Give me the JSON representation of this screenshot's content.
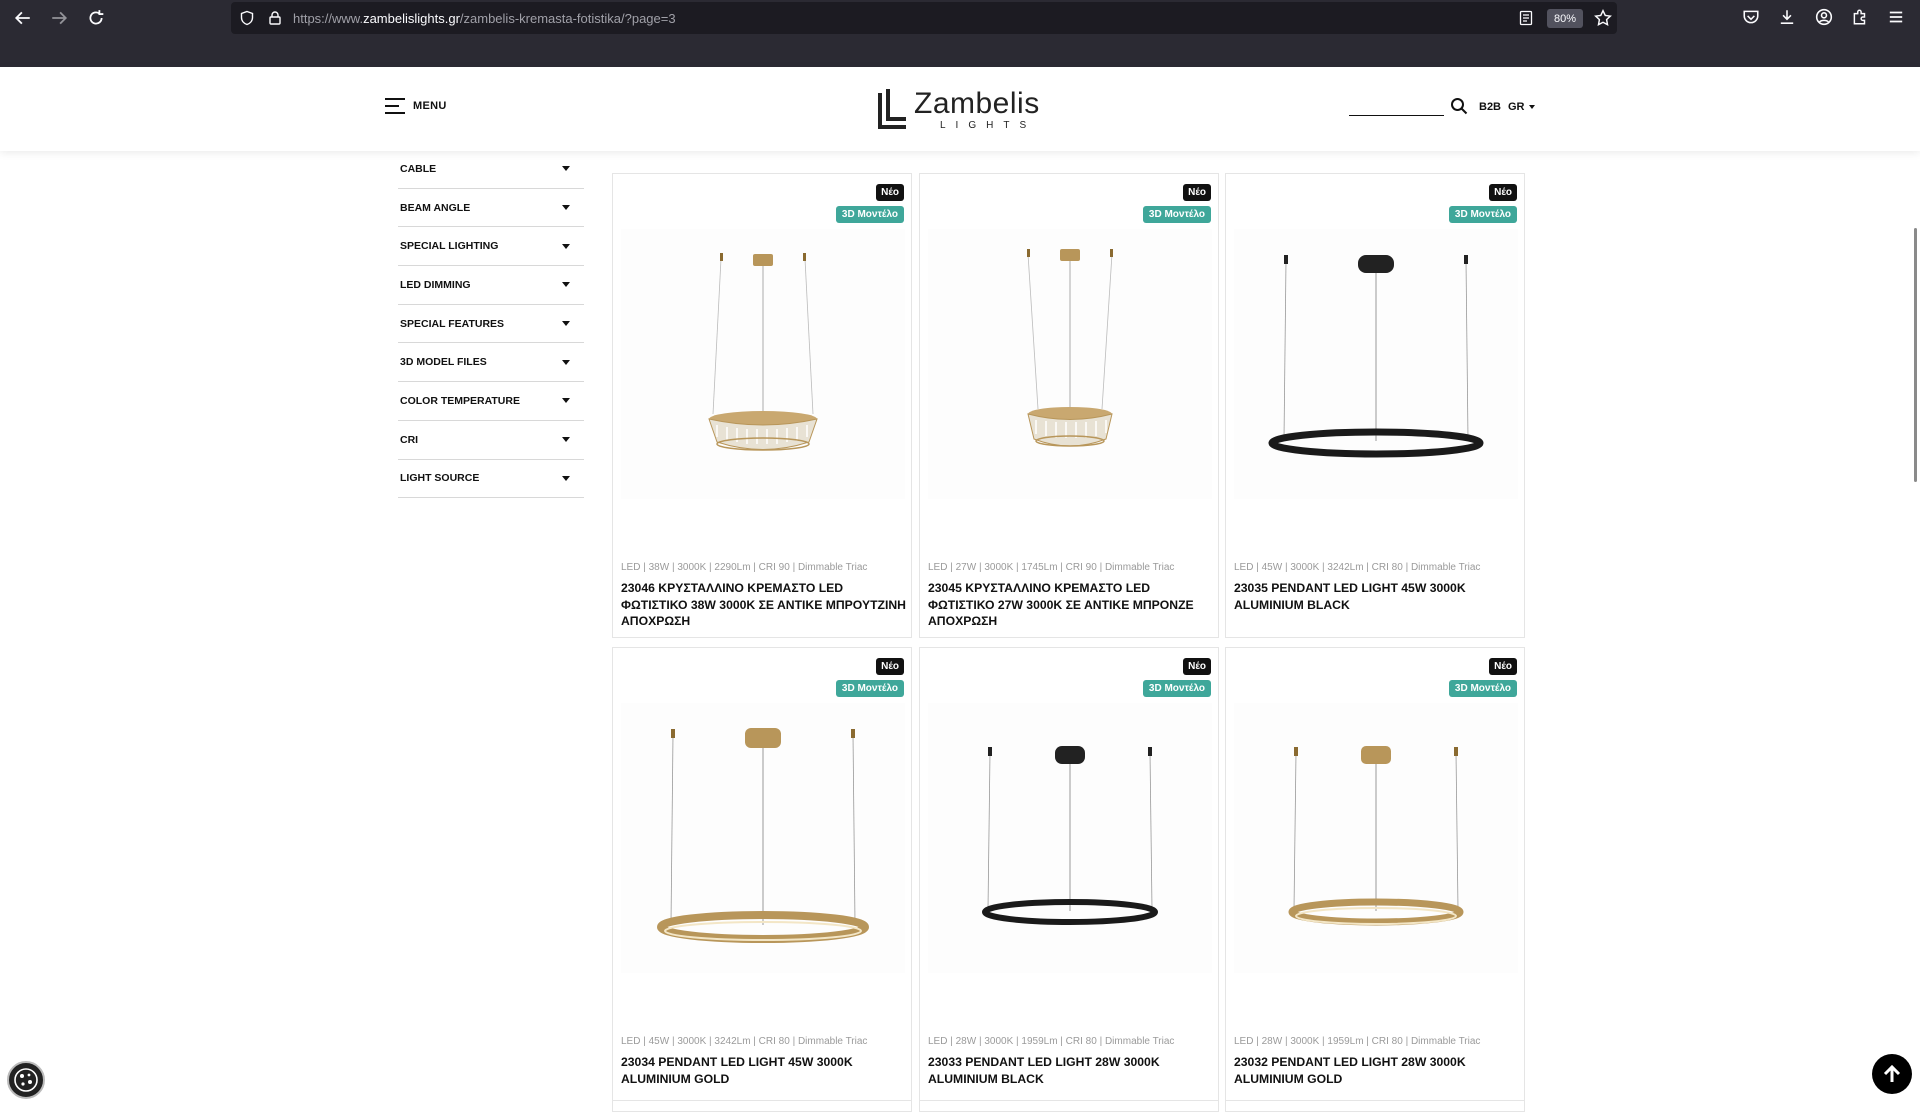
{
  "browser": {
    "url_prefix": "https://www.",
    "url_host": "zambelislights.gr",
    "url_path": "/zambelis-kremasta-fotistika/?page=3",
    "zoom": "80%"
  },
  "header": {
    "menu_label": "MENU",
    "logo_name": "Zambelis",
    "logo_sub": "LIGHTS",
    "b2b_label": "B2B",
    "lang_label": "GR"
  },
  "filters": [
    {
      "label": "CABLE"
    },
    {
      "label": "BEAM ANGLE"
    },
    {
      "label": "SPECIAL LIGHTING"
    },
    {
      "label": "LED DIMMING"
    },
    {
      "label": "SPECIAL FEATURES"
    },
    {
      "label": "3D MODEL FILES"
    },
    {
      "label": "COLOR TEMPERATURE"
    },
    {
      "label": "CRI"
    },
    {
      "label": "LIGHT SOURCE"
    }
  ],
  "badges": {
    "new": "Νέο",
    "model3d": "3D Μοντέλο"
  },
  "products": [
    {
      "specs": "LED | 38W | 3000K | 2290Lm | CRI 90 | Dimmable Triac",
      "title": "23046 ΚΡΥΣΤΑΛΛΙΝΟ ΚΡΕΜΑΣΤΟ LED ΦΩΤΙΣΤΙΚΟ 38W 3000K ΣΕ ΑΝΤΙΚΕ ΜΠΡΟΥΤΖΙΝΗ ΑΠΟΧΡΩΣΗ",
      "image": "crystal-pendant-brass"
    },
    {
      "specs": "LED | 27W | 3000K | 1745Lm | CRI 90 | Dimmable Triac",
      "title": "23045 ΚΡΥΣΤΑΛΛΙΝΟ ΚΡΕΜΑΣΤΟ LED ΦΩΤΙΣΤΙΚΟ 27W 3000K ΣΕ ΑΝΤΙΚΕ ΜΠΡΟΝΖΕ ΑΠΟΧΡΩΣΗ",
      "image": "crystal-pendant-bronze"
    },
    {
      "specs": "LED | 45W | 3000K | 3242Lm | CRI 80 | Dimmable Triac",
      "title": "23035 PENDANT LED LIGHT 45W 3000K ALUMINIUM BLACK",
      "image": "ring-pendant-black"
    },
    {
      "specs": "LED | 45W | 3000K | 3242Lm | CRI 80 | Dimmable Triac",
      "title": "23034 PENDANT LED LIGHT 45W 3000K ALUMINIUM GOLD",
      "image": "ring-pendant-gold"
    },
    {
      "specs": "LED | 28W | 3000K | 1959Lm | CRI 80 | Dimmable Triac",
      "title": "23033 PENDANT LED LIGHT 28W 3000K ALUMINIUM BLACK",
      "image": "ring-pendant-black"
    },
    {
      "specs": "LED | 28W | 3000K | 1959Lm | CRI 80 | Dimmable Triac",
      "title": "23032 PENDANT LED LIGHT 28W 3000K ALUMINIUM GOLD",
      "image": "ring-pendant-gold"
    }
  ],
  "colors": {
    "accent_teal": "#3fa79a",
    "brass": "#b8965a",
    "black": "#1a1a1a"
  }
}
